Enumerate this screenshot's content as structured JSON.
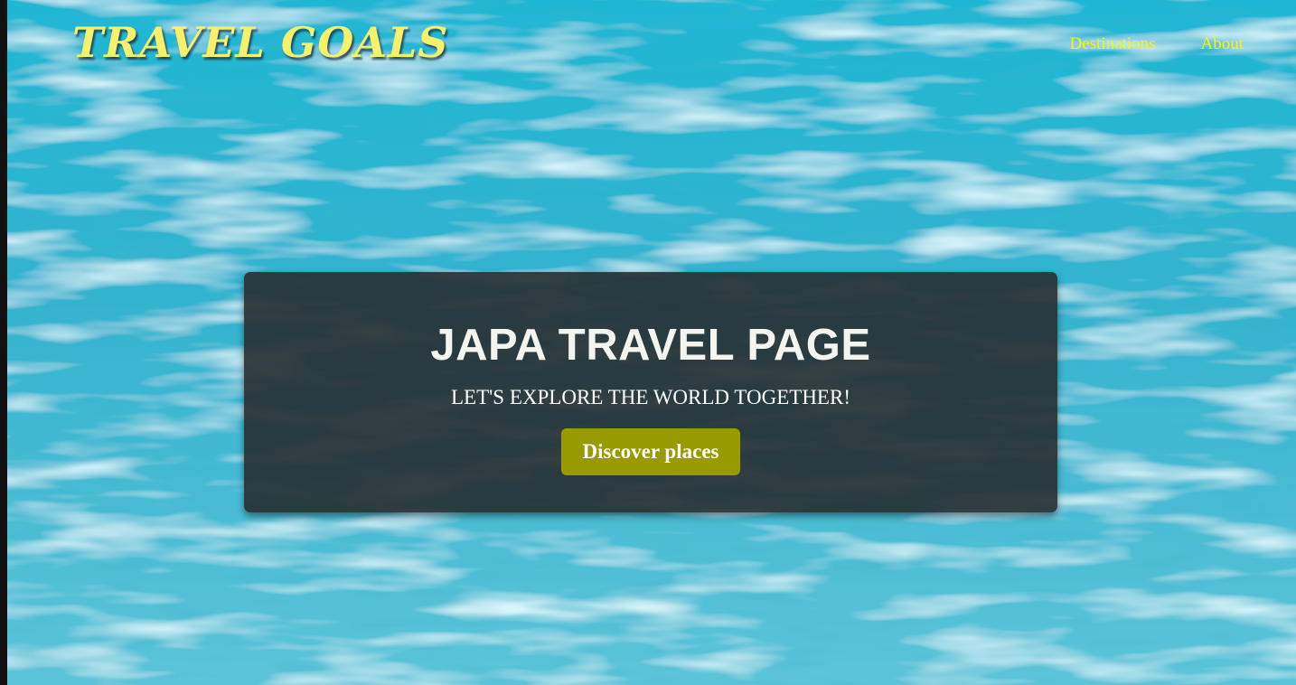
{
  "navbar": {
    "logo": "TRAVEL GOALS",
    "links": [
      {
        "label": "Destinations"
      },
      {
        "label": "About"
      }
    ]
  },
  "hero": {
    "title": "JAPA TRAVEL PAGE",
    "subtitle": "LET'S EXPLORE THE WORLD TOGETHER!",
    "button_label": "Discover places"
  },
  "colors": {
    "logo": "#f7f06a",
    "nav_link": "#f7f700",
    "card_bg": "#262d30",
    "button_bg": "#999900",
    "water": "#35b4cf"
  }
}
